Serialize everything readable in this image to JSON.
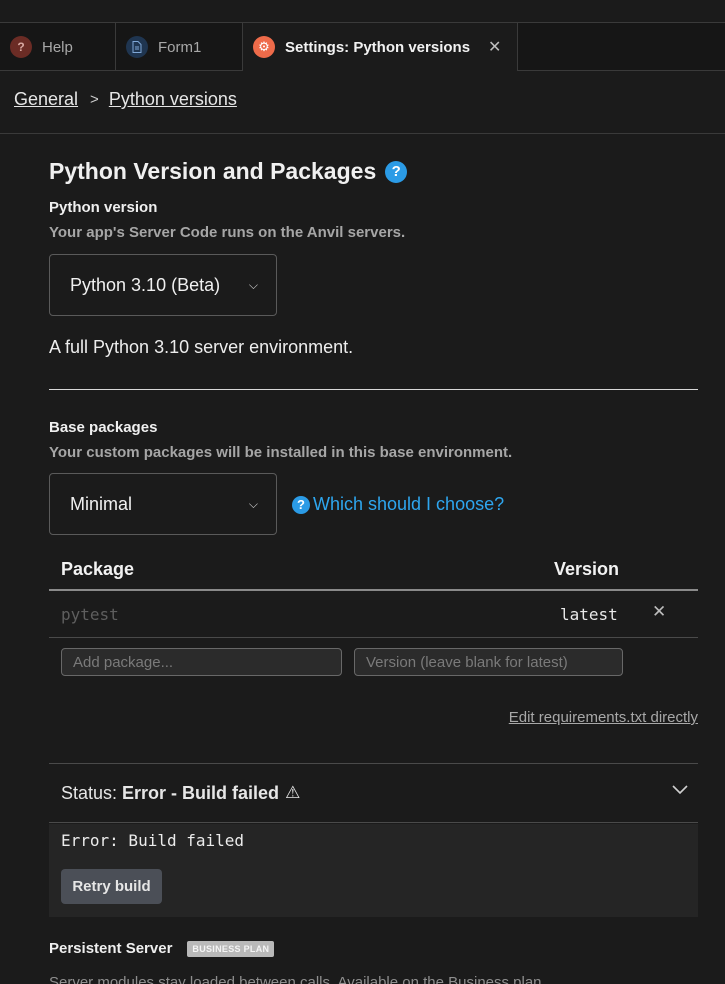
{
  "tabs": [
    {
      "label": "Help",
      "icon": "question-icon"
    },
    {
      "label": "Form1",
      "icon": "document-icon"
    },
    {
      "label": "Settings: Python versions",
      "icon": "gear-icon",
      "active": true
    }
  ],
  "breadcrumb": {
    "root": "General",
    "current": "Python versions"
  },
  "section": {
    "title": "Python Version and Packages",
    "python_version_label": "Python version",
    "python_version_hint": "Your app's Server Code runs on the Anvil servers.",
    "python_version_selected": "Python 3.10 (Beta)",
    "python_version_desc": "A full Python 3.10 server environment.",
    "base_packages_label": "Base packages",
    "base_packages_hint": "Your custom packages will be installed in this base environment.",
    "base_packages_selected": "Minimal",
    "which_link": "Which should I choose?"
  },
  "packages_table": {
    "headers": {
      "package": "Package",
      "version": "Version"
    },
    "rows": [
      {
        "package": "pytest",
        "version": "latest"
      }
    ],
    "add_package_placeholder": "Add package...",
    "version_placeholder": "Version (leave blank for latest)"
  },
  "edit_requirements_link": "Edit requirements.txt directly",
  "status": {
    "label": "Status:",
    "value": "Error - Build failed"
  },
  "error": {
    "text": "Error: Build failed",
    "retry_label": "Retry build"
  },
  "persistent": {
    "title": "Persistent Server",
    "badge": "BUSINESS PLAN",
    "desc": "Server modules stay loaded between calls. Available on the Business plan."
  },
  "colors": {
    "accent": "#2ea6ef",
    "settings_icon": "#ee6b4a",
    "background": "#1b1b1b"
  }
}
